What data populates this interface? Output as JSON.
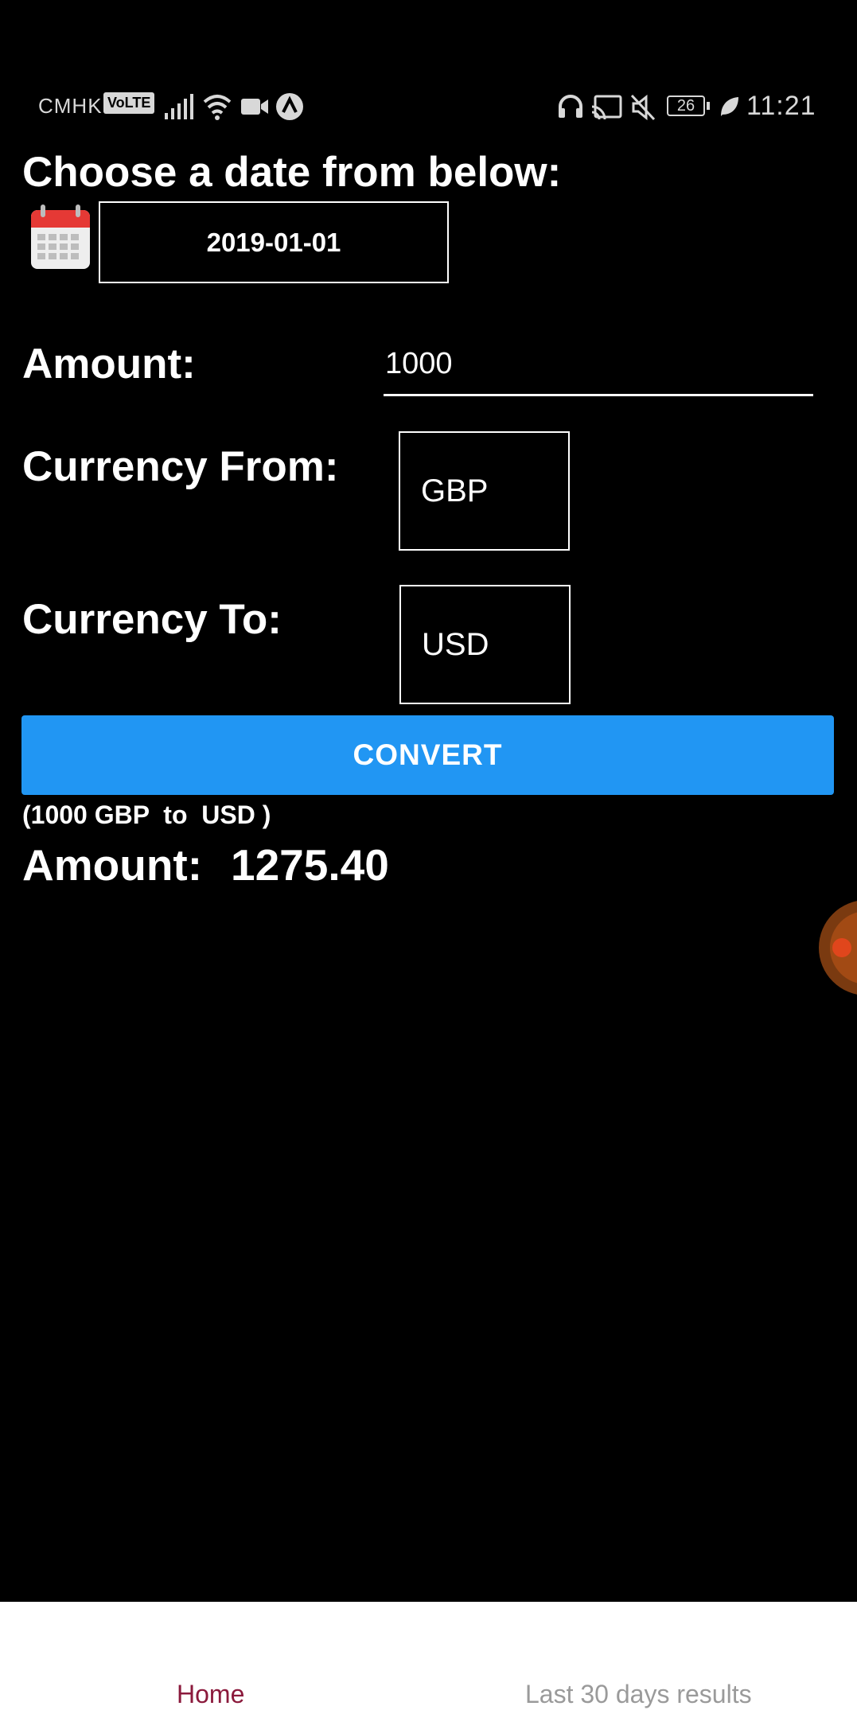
{
  "status_bar": {
    "carrier": "CMHK",
    "volte": "VoLTE",
    "battery": "26",
    "time": "11:21",
    "icons": [
      "signal-icon",
      "wifi-icon",
      "video-camera-icon",
      "navigation-icon",
      "headphones-icon",
      "cast-icon",
      "mute-icon",
      "battery-icon",
      "leaf-icon"
    ]
  },
  "form": {
    "title": "Choose a date from below:",
    "date_value": "2019-01-01",
    "amount_label": "Amount:",
    "amount_value": "1000",
    "currency_from_label": "Currency From:",
    "currency_from_value": "GBP",
    "currency_to_label": "Currency To:",
    "currency_to_value": "USD",
    "convert_label": "CONVERT"
  },
  "result": {
    "summary": "(1000 GBP  to  USD )",
    "label": "Amount:",
    "value": "1275.40"
  },
  "bottom_nav": {
    "tabs": [
      {
        "label": "Home",
        "active": true
      },
      {
        "label": "Last 30 days results",
        "active": false
      }
    ]
  },
  "colors": {
    "background": "#000000",
    "accent": "#2196f3",
    "active_tab": "#8b1a3c",
    "inactive_tab": "#9a9a9a"
  }
}
